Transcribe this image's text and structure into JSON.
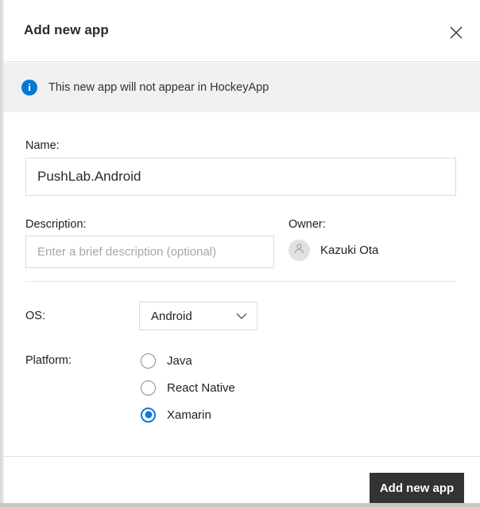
{
  "dialog": {
    "title": "Add new app",
    "close_icon": "close-icon"
  },
  "banner": {
    "icon": "info-icon",
    "icon_glyph": "i",
    "text": "This new app will not appear in HockeyApp",
    "background": "#f0f0f0",
    "icon_color": "#0078d4"
  },
  "form": {
    "name": {
      "label": "Name:",
      "value": "PushLab.Android",
      "placeholder": ""
    },
    "description": {
      "label": "Description:",
      "value": "",
      "placeholder": "Enter a brief description (optional)"
    },
    "owner": {
      "label": "Owner:",
      "name": "Kazuki Ota",
      "avatar_icon": "person-icon"
    },
    "os": {
      "label": "OS:",
      "selected": "Android",
      "options": [
        "Android"
      ],
      "chevron_icon": "chevron-down-icon"
    },
    "platform": {
      "label": "Platform:",
      "options": [
        {
          "label": "Java",
          "selected": false
        },
        {
          "label": "React Native",
          "selected": false
        },
        {
          "label": "Xamarin",
          "selected": true
        }
      ],
      "selected_color": "#0f7bd4"
    }
  },
  "footer": {
    "submit_label": "Add new app",
    "submit_color": "#333333"
  }
}
